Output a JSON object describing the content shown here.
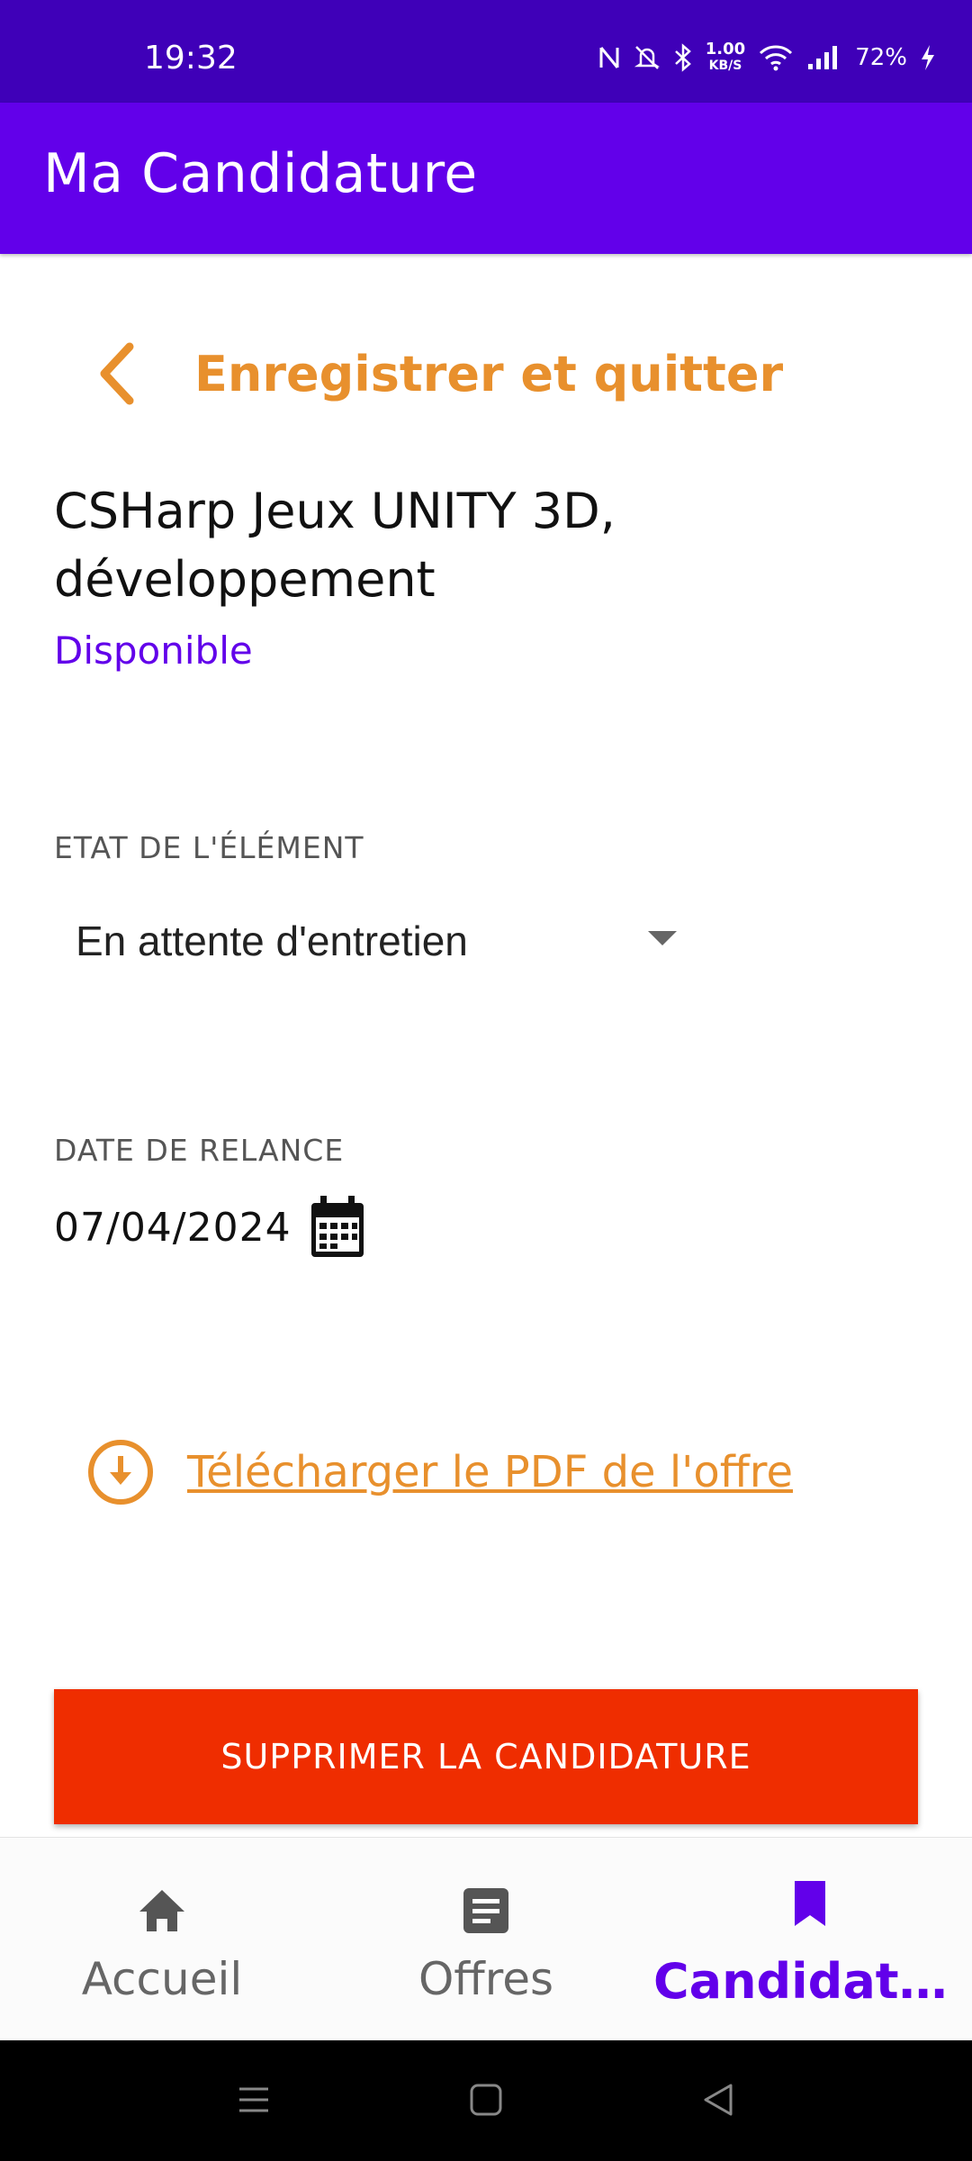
{
  "status_bar": {
    "time": "19:32",
    "net_speed_value": "1.00",
    "net_speed_unit": "KB/S",
    "battery": "72%",
    "icons": [
      "nfc-icon",
      "mute-icon",
      "bluetooth-icon",
      "wifi-icon",
      "signal-icon",
      "charging-icon"
    ]
  },
  "app_bar": {
    "title": "Ma Candidature"
  },
  "back": {
    "label": "Enregistrer et quitter"
  },
  "offer": {
    "title": "CSHarp Jeux UNITY 3D, développement",
    "status": "Disponible"
  },
  "state_field": {
    "label": "ETAT DE L'ÉLÉMENT",
    "value": "En attente d'entretien"
  },
  "date_field": {
    "label": "DATE DE RELANCE",
    "value": "07/04/2024"
  },
  "download": {
    "label": "Télécharger le PDF de l'offre"
  },
  "delete_button": {
    "label": "SUPPRIMER LA CANDIDATURE"
  },
  "bottom_nav": {
    "items": [
      {
        "label": "Accueil",
        "icon": "home-icon",
        "active": false
      },
      {
        "label": "Offres",
        "icon": "article-icon",
        "active": false
      },
      {
        "label": "Candidatur…",
        "icon": "bookmark-icon",
        "active": true
      }
    ]
  },
  "colors": {
    "status_bar": "#3f00b8",
    "primary": "#6200ea",
    "accent_orange": "#e8902d",
    "danger": "#ef2d00"
  }
}
